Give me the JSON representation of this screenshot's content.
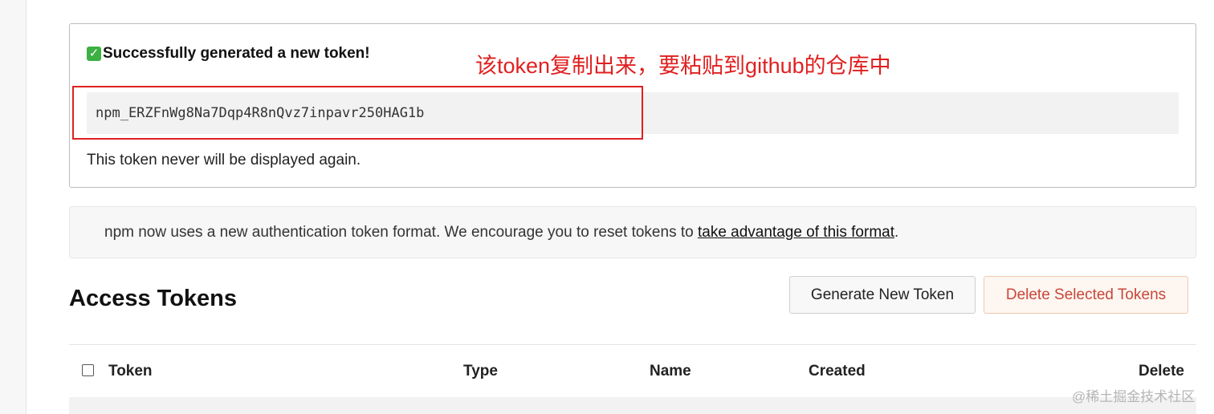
{
  "success": {
    "title": "Successfully generated a new token!",
    "check_icon_glyph": "✓",
    "token_value": "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",
    "warning": "This token never will be displayed again."
  },
  "annotation": {
    "text": "该token复制出来，要粘贴到github的仓库中",
    "color": "#e02020"
  },
  "notice": {
    "text_before": "npm now uses a new authentication token format. We encourage you to reset tokens to ",
    "link_text": "take advantage of this format",
    "text_after": "."
  },
  "tokens": {
    "title": "Access Tokens",
    "generate_label": "Generate New Token",
    "delete_label": "Delete Selected Tokens",
    "columns": [
      "Token",
      "Type",
      "Name",
      "Created",
      "Delete"
    ]
  },
  "watermark": "@稀土掘金技术社区",
  "colors": {
    "success_check": "#3cb043",
    "delete_text": "#c9473a",
    "highlight": "#e02020"
  }
}
